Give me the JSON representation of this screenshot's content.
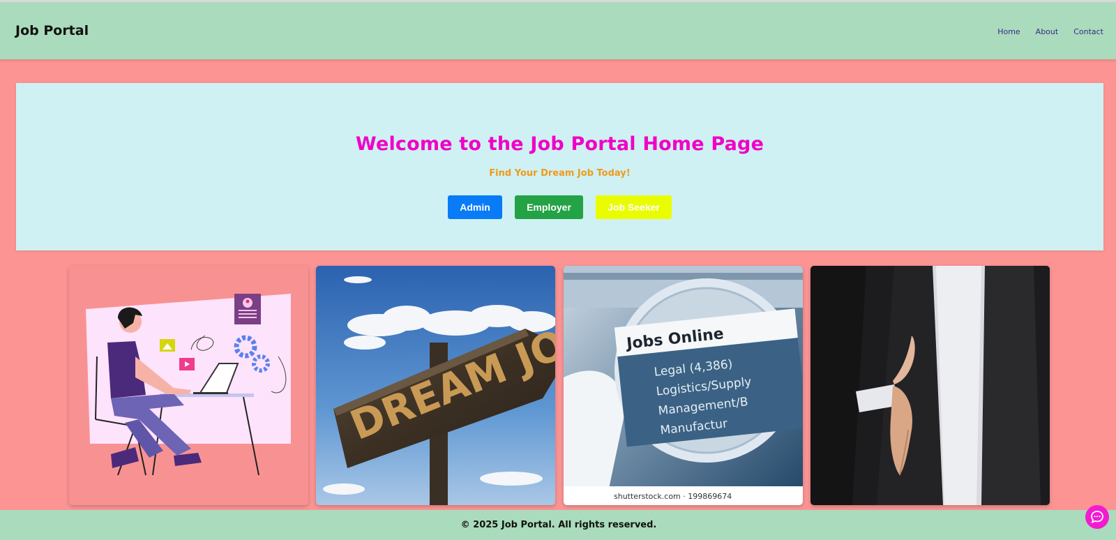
{
  "navbar": {
    "brand": "Job Portal",
    "links": [
      "Home",
      "About",
      "Contact"
    ]
  },
  "hero": {
    "title": "Welcome to the Job Portal Home Page",
    "subtitle": "Find Your Dream Job Today!",
    "buttons": {
      "admin": "Admin",
      "employer": "Employer",
      "job_seeker": "Job Seeker"
    }
  },
  "gallery": {
    "images": [
      {
        "name": "person-at-laptop-illustration"
      },
      {
        "name": "dream-job-signpost-photo",
        "text": "DREAM JOB"
      },
      {
        "name": "jobs-online-magnifier-photo",
        "heading": "Jobs Online",
        "lines": [
          "Legal (4,386)",
          "Logistics/Supply",
          "Management/B",
          "Manufactur"
        ],
        "watermark": "shutterstock.com · 199869674"
      },
      {
        "name": "handshake-businessman-photo"
      }
    ]
  },
  "footer": {
    "copyright": "© 2025 Job Portal. All rights reserved."
  },
  "colors": {
    "page_bg": "#fc9494",
    "navbar_bg": "#aadbbc",
    "hero_bg": "#cff1f3",
    "title": "#f000c8",
    "subtitle": "#f09a1a",
    "admin_button": "#0a7bf7",
    "employer_button": "#23a345",
    "job_seeker_button": "#eafd00",
    "chat_button": "#f21bd0"
  },
  "icons": {
    "chat": "chat-bubble-icon"
  }
}
